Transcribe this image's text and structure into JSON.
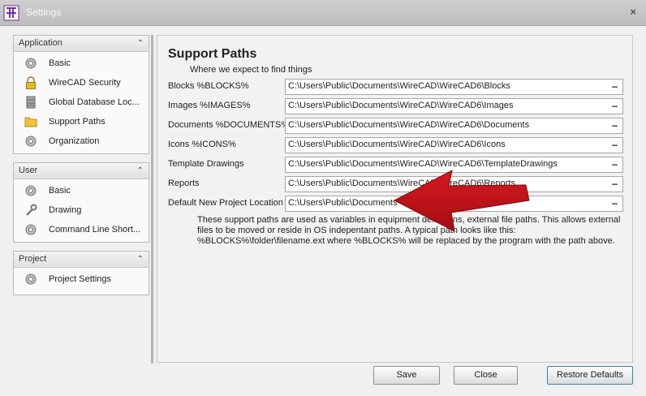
{
  "window": {
    "title": "Settings",
    "close_glyph": "×"
  },
  "sidebar": {
    "groups": [
      {
        "title": "Application",
        "items": [
          {
            "label": "Basic",
            "icon": "gear-icon"
          },
          {
            "label": "WireCAD Security",
            "icon": "lock-icon"
          },
          {
            "label": "Global Database Loc...",
            "icon": "database-icon"
          },
          {
            "label": "Support Paths",
            "icon": "folder-icon"
          },
          {
            "label": "Organization",
            "icon": "gear-icon"
          }
        ]
      },
      {
        "title": "User",
        "items": [
          {
            "label": "Basic",
            "icon": "gear-icon"
          },
          {
            "label": "Drawing",
            "icon": "wrench-icon"
          },
          {
            "label": "Command Line Short...",
            "icon": "gear-icon"
          }
        ]
      },
      {
        "title": "Project",
        "items": [
          {
            "label": "Project Settings",
            "icon": "gear-icon"
          }
        ]
      }
    ],
    "collapse_glyph": "⌃"
  },
  "main": {
    "title": "Support Paths",
    "subtitle": "Where we expect to find things",
    "rows": [
      {
        "label": "Blocks %BLOCKS%",
        "value": "C:\\Users\\Public\\Documents\\WireCAD\\WireCAD6\\Blocks"
      },
      {
        "label": "Images %IMAGES%",
        "value": "C:\\Users\\Public\\Documents\\WireCAD\\WireCAD6\\Images"
      },
      {
        "label": "Documents %DOCUMENTS%",
        "value": "C:\\Users\\Public\\Documents\\WireCAD\\WireCAD6\\Documents"
      },
      {
        "label": "Icons %ICONS%",
        "value": "C:\\Users\\Public\\Documents\\WireCAD\\WireCAD6\\Icons"
      },
      {
        "label": "Template Drawings",
        "value": "C:\\Users\\Public\\Documents\\WireCAD\\WireCAD6\\TemplateDrawings"
      },
      {
        "label": "Reports",
        "value": "C:\\Users\\Public\\Documents\\WireCAD\\WireCAD6\\Reports"
      },
      {
        "label": "Default New Project Location",
        "value": "C:\\Users\\Public\\Documents"
      }
    ],
    "browse_glyph": "...",
    "info_lines": [
      "These support paths are used as variables in equipment definitions, external file paths. This allows external",
      "files to be moved or reside in OS indepentant paths. A typical path looks like this:",
      "%BLOCKS%\\folder\\filename.ext where %BLOCKS% will be replaced by the program with the path above."
    ]
  },
  "buttons": {
    "save": "Save",
    "close": "Close",
    "restore": "Restore Defaults"
  },
  "colors": {
    "annotation_arrow": "#c0141b",
    "restore_button_border": "#3c7fb1"
  }
}
